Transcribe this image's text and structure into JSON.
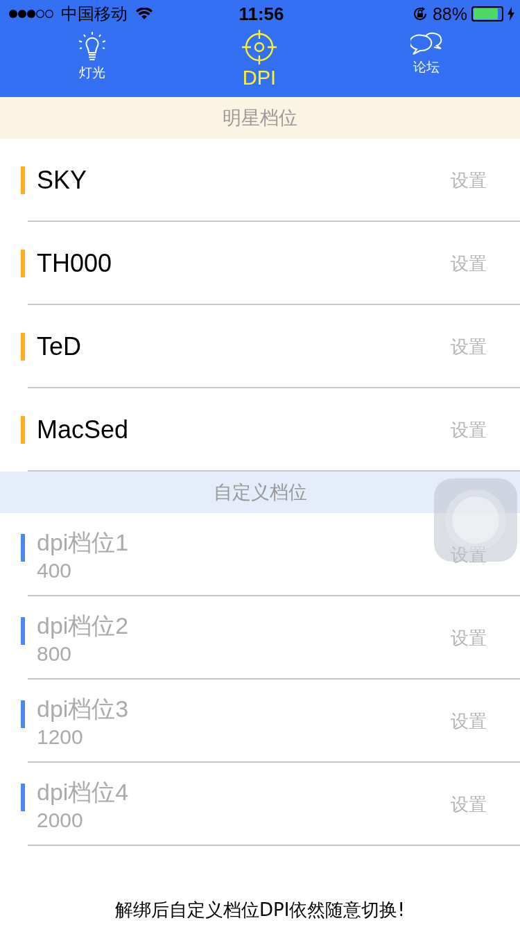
{
  "status_bar": {
    "carrier": "中国移动",
    "time": "11:56",
    "battery": "88%"
  },
  "tabs": [
    {
      "label": "灯光",
      "selected": false
    },
    {
      "label": "DPI",
      "selected": true
    },
    {
      "label": "论坛",
      "selected": false
    }
  ],
  "sections": [
    {
      "title": "明星档位",
      "kind": "star",
      "rows": [
        {
          "name": "SKY",
          "action": "设置"
        },
        {
          "name": "TH000",
          "action": "设置"
        },
        {
          "name": "TeD",
          "action": "设置"
        },
        {
          "name": "MacSed",
          "action": "设置"
        }
      ]
    },
    {
      "title": "自定义档位",
      "kind": "custom",
      "rows": [
        {
          "name": "dpi档位1",
          "value": "400",
          "action": "设置"
        },
        {
          "name": "dpi档位2",
          "value": "800",
          "action": "设置"
        },
        {
          "name": "dpi档位3",
          "value": "1200",
          "action": "设置"
        },
        {
          "name": "dpi档位4",
          "value": "2000",
          "action": "设置"
        }
      ]
    }
  ],
  "footer": "解绑后自定义档位DPI依然随意切换!"
}
